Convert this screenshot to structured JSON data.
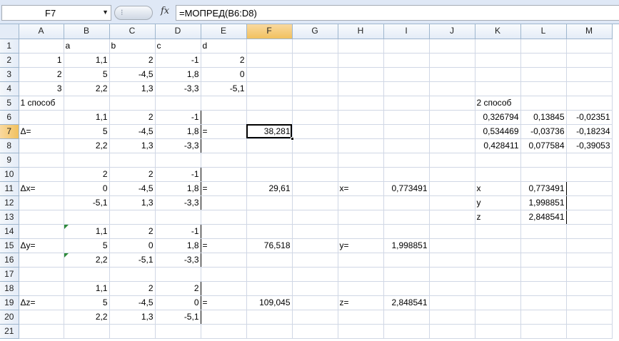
{
  "formula_bar": {
    "name_box": "F7",
    "fx_label": "fx",
    "formula": "=МОПРЕД(B6:D8)"
  },
  "columns": [
    "A",
    "B",
    "C",
    "D",
    "E",
    "F",
    "G",
    "H",
    "I",
    "J",
    "K",
    "L",
    "M"
  ],
  "selected_column": "F",
  "selected_row": 7,
  "rows": [
    {
      "n": "1",
      "cells": {
        "B": "a",
        "C": "b",
        "D": "c",
        "E": "d"
      }
    },
    {
      "n": "2",
      "cells": {
        "A": "1",
        "B": "1,1",
        "C": "2",
        "D": "-1",
        "E": "2"
      }
    },
    {
      "n": "3",
      "cells": {
        "A": "2",
        "B": "5",
        "C": "-4,5",
        "D": "1,8",
        "E": "0"
      }
    },
    {
      "n": "4",
      "cells": {
        "A": "3",
        "B": "2,2",
        "C": "1,3",
        "D": "-3,3",
        "E": "-5,1"
      }
    },
    {
      "n": "5",
      "cells": {
        "A": "1 способ",
        "K": "2 способ"
      }
    },
    {
      "n": "6",
      "cells": {
        "B": "1,1",
        "C": "2",
        "D": "-1",
        "K": "0,326794",
        "L": "0,13845",
        "M": "-0,02351"
      }
    },
    {
      "n": "7",
      "cells": {
        "A": "Δ=",
        "B": "5",
        "C": "-4,5",
        "D": "1,8",
        "E": "=",
        "F": "38,281",
        "K": "0,534469",
        "L": "-0,03736",
        "M": "-0,18234"
      }
    },
    {
      "n": "8",
      "cells": {
        "B": "2,2",
        "C": "1,3",
        "D": "-3,3",
        "K": "0,428411",
        "L": "0,077584",
        "M": "-0,39053"
      }
    },
    {
      "n": "9",
      "cells": {}
    },
    {
      "n": "10",
      "cells": {
        "B": "2",
        "C": "2",
        "D": "-1"
      }
    },
    {
      "n": "11",
      "cells": {
        "A": "Δx=",
        "B": "0",
        "C": "-4,5",
        "D": "1,8",
        "E": "=",
        "F": "29,61",
        "H": "x=",
        "I": "0,773491",
        "K": "x",
        "L": "0,773491"
      }
    },
    {
      "n": "12",
      "cells": {
        "B": "-5,1",
        "C": "1,3",
        "D": "-3,3",
        "K": "y",
        "L": "1,998851"
      }
    },
    {
      "n": "13",
      "cells": {
        "K": "z",
        "L": "2,848541"
      }
    },
    {
      "n": "14",
      "cells": {
        "B": "1,1",
        "C": "2",
        "D": "-1"
      }
    },
    {
      "n": "15",
      "cells": {
        "A": "Δy=",
        "B": "5",
        "C": "0",
        "D": "1,8",
        "E": "=",
        "F": "76,518",
        "H": "y=",
        "I": "1,998851"
      }
    },
    {
      "n": "16",
      "cells": {
        "B": "2,2",
        "C": "-5,1",
        "D": "-3,3"
      }
    },
    {
      "n": "17",
      "cells": {}
    },
    {
      "n": "18",
      "cells": {
        "B": "1,1",
        "C": "2",
        "D": "2"
      }
    },
    {
      "n": "19",
      "cells": {
        "A": "Δz=",
        "B": "5",
        "C": "-4,5",
        "D": "0",
        "E": "=",
        "F": "109,045",
        "H": "z=",
        "I": "2,848541"
      }
    },
    {
      "n": "20",
      "cells": {
        "B": "2,2",
        "C": "1,3",
        "D": "-5,1"
      }
    },
    {
      "n": "21",
      "cells": {}
    }
  ]
}
